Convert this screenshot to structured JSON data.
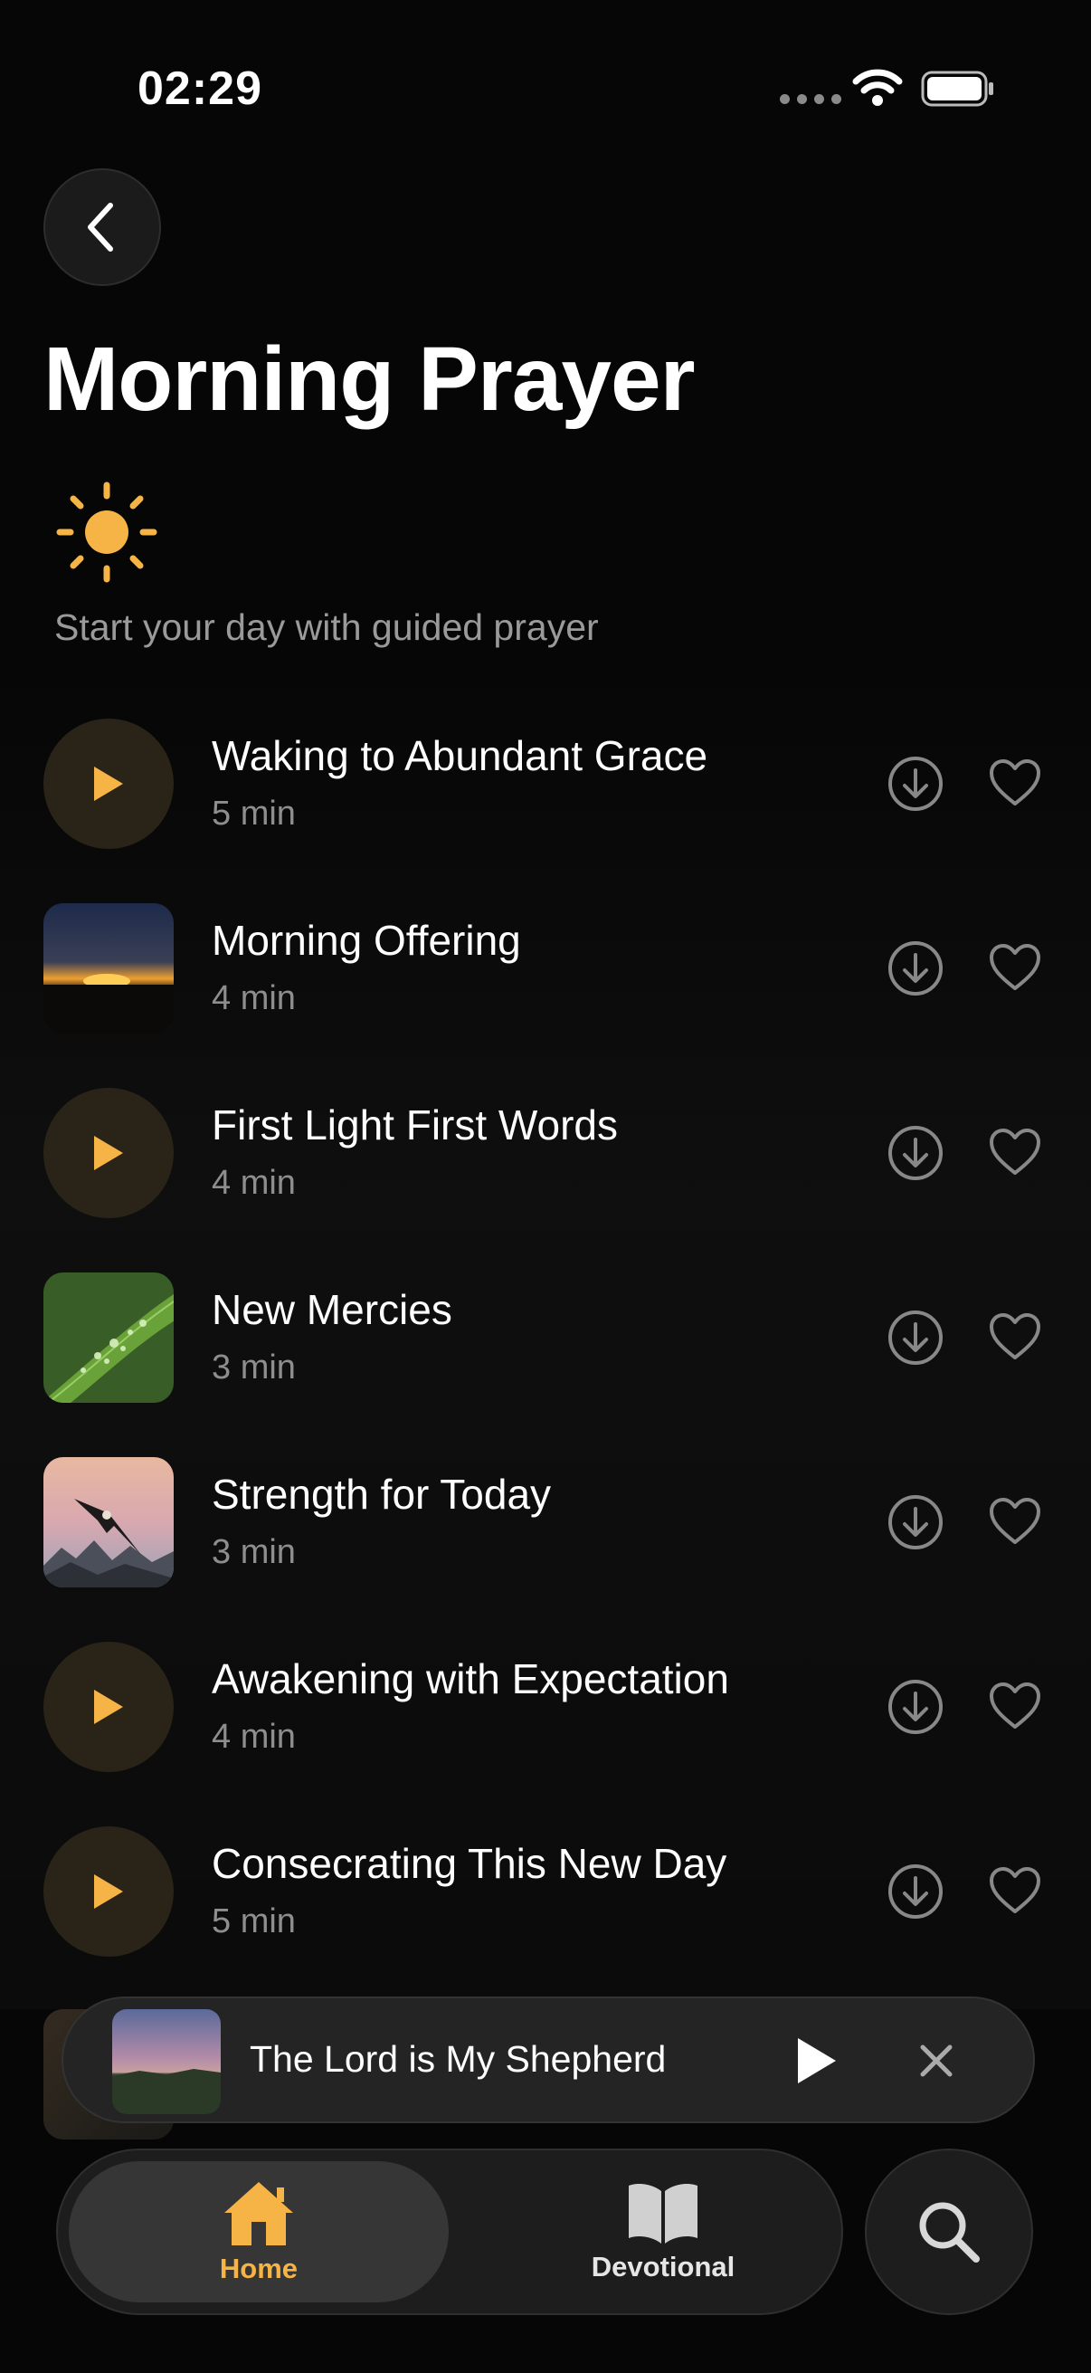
{
  "status_bar": {
    "time": "02:29"
  },
  "header": {
    "title": "Morning Prayer",
    "subtitle": "Start your day with guided prayer"
  },
  "prayers": [
    {
      "title": "Waking to Abundant Grace",
      "duration": "5 min",
      "thumb": "play"
    },
    {
      "title": "Morning Offering",
      "duration": "4 min",
      "thumb": "sunrise-image"
    },
    {
      "title": "First Light First Words",
      "duration": "4 min",
      "thumb": "play"
    },
    {
      "title": "New Mercies",
      "duration": "3 min",
      "thumb": "leaf-dew-image"
    },
    {
      "title": "Strength for Today",
      "duration": "3 min",
      "thumb": "eagle-image"
    },
    {
      "title": "Awakening with Expectation",
      "duration": "4 min",
      "thumb": "play"
    },
    {
      "title": "Consecrating This New Day",
      "duration": "5 min",
      "thumb": "play"
    }
  ],
  "mini_player": {
    "title": "The Lord is My Shepherd"
  },
  "tab_bar": {
    "tabs": [
      {
        "label": "Home",
        "icon": "house-icon",
        "active": true
      },
      {
        "label": "Devotional",
        "icon": "book-icon",
        "active": false
      }
    ],
    "search_icon": "search-icon"
  },
  "colors": {
    "accent": "#F5B445",
    "background": "#060606",
    "muted": "#8E8E8E"
  }
}
